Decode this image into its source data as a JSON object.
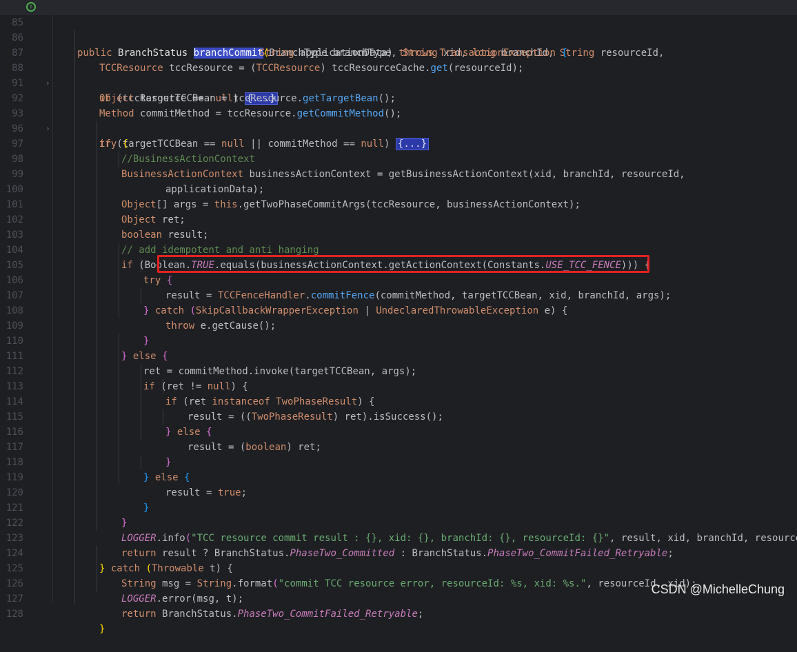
{
  "editor": {
    "watermark": "CSDN @MichelleChung",
    "gutter_icon": "implementation-marker-icon",
    "highlight_color": "#e32222",
    "lines": [
      {
        "n": "85"
      },
      {
        "n": "86"
      },
      {
        "n": "87"
      },
      {
        "n": "88"
      },
      {
        "n": "91"
      },
      {
        "n": "92"
      },
      {
        "n": "93"
      },
      {
        "n": "96"
      },
      {
        "n": "97"
      },
      {
        "n": "98"
      },
      {
        "n": "99"
      },
      {
        "n": "100"
      },
      {
        "n": "101"
      },
      {
        "n": "102"
      },
      {
        "n": "103"
      },
      {
        "n": "104"
      },
      {
        "n": "105"
      },
      {
        "n": "106"
      },
      {
        "n": "107"
      },
      {
        "n": "108"
      },
      {
        "n": "109"
      },
      {
        "n": "110"
      },
      {
        "n": "111"
      },
      {
        "n": "112"
      },
      {
        "n": "113"
      },
      {
        "n": "114"
      },
      {
        "n": "115"
      },
      {
        "n": "116"
      },
      {
        "n": "117"
      },
      {
        "n": "118"
      },
      {
        "n": "119"
      },
      {
        "n": "120"
      },
      {
        "n": "121"
      },
      {
        "n": "122"
      },
      {
        "n": "123"
      },
      {
        "n": "124"
      },
      {
        "n": "125"
      },
      {
        "n": "126"
      },
      {
        "n": "127"
      },
      {
        "n": "128"
      }
    ],
    "folded_block": "{...}",
    "text": {
      "l85a": "public ",
      "l85b": "BranchStatus ",
      "l85c": "branchCommit",
      "l85d": "(",
      "l85e": "BranchType branchType, ",
      "l85f": "String ",
      "l85g": "xid, ",
      "l85h": "long ",
      "l85i": "branchId, ",
      "l85j": "String ",
      "l85k": "resourceId,",
      "l86a": "String ",
      "l86b": "applicationData) ",
      "l86c": "throws ",
      "l86d": "TransactionException ",
      "l86e": "{",
      "l87a": "TCCResource ",
      "l87b": "tccResource = (",
      "l87c": "TCCResource",
      "l87d": ") tccResourceCache.",
      "l87e": "get",
      "l87f": "(resourceId);",
      "l88a": "if ",
      "l88b": "(tccResource == ",
      "l88c": "null",
      "l88d": ") ",
      "l91a": "Object ",
      "l91b": "targetTCCBean = tccResource.",
      "l91c": "getTargetBean",
      "l91d": "();",
      "l92a": "Method ",
      "l92b": "commitMethod = tccResource.",
      "l92c": "getCommitMethod",
      "l92d": "();",
      "l93a": "if ",
      "l93b": "(targetTCCBean == ",
      "l93c": "null",
      "l93d": " || commitMethod == ",
      "l93e": "null",
      "l93f": ") ",
      "l96a": "try ",
      "l96b": "{",
      "l97": "//BusinessActionContext",
      "l98a": "BusinessActionContext ",
      "l98b": "businessActionContext = ",
      "l98c": "getBusinessActionContext",
      "l98d": "(xid, branchId, resourceId,",
      "l99": "applicationData);",
      "l100a": "Object",
      "l100b": "[] args = ",
      "l100c": "this",
      "l100d": ".",
      "l100e": "getTwoPhaseCommitArgs",
      "l100f": "(tccResource, businessActionContext);",
      "l101a": "Object ",
      "l101b": "ret;",
      "l102a": "boolean ",
      "l102b": "result;",
      "l103": "// add idempotent and anti hanging",
      "l104a": "if ",
      "l104b": "(Boolean.",
      "l104c": "TRUE",
      "l104d": ".",
      "l104e": "equals",
      "l104f": "(businessActionContext.",
      "l104g": "getActionContext",
      "l104h": "(Constants.",
      "l104i": "USE_TCC_FENCE",
      "l104j": "))) {",
      "l105a": "try ",
      "l105b": "{",
      "l106a": "result = ",
      "l106b": "TCCFenceHandler",
      "l106c": ".",
      "l106d": "commitFence",
      "l106e": "(commitMethod, targetTCCBean, xid, branchId, args);",
      "l107a": "} ",
      "l107b": "catch ",
      "l107c": "(",
      "l107d": "SkipCallbackWrapperException",
      "l107e": " | ",
      "l107f": "UndeclaredThrowableException",
      "l107g": " e) {",
      "l108a": "throw ",
      "l108b": "e.",
      "l108c": "getCause",
      "l108d": "();",
      "l109": "}",
      "l110a": "} ",
      "l110b": "else ",
      "l110c": "{",
      "l111a": "ret = commitMethod.",
      "l111b": "invoke",
      "l111c": "(targetTCCBean, args);",
      "l112a": "if ",
      "l112b": "(ret != ",
      "l112c": "null",
      "l112d": ") {",
      "l113a": "if ",
      "l113b": "(ret ",
      "l113c": "instanceof ",
      "l113d": "TwoPhaseResult",
      "l113e": ") {",
      "l114a": "result = ((",
      "l114b": "TwoPhaseResult",
      "l114c": ") ret).",
      "l114d": "isSuccess",
      "l114e": "();",
      "l115a": "} ",
      "l115b": "else ",
      "l115c": "{",
      "l116a": "result = (",
      "l116b": "boolean",
      "l116c": ") ret;",
      "l117": "}",
      "l118a": "} ",
      "l118b": "else ",
      "l118c": "{",
      "l119a": "result = ",
      "l119b": "true",
      "l119c": ";",
      "l120": "}",
      "l121": "}",
      "l122a": "LOGGER",
      "l122b": ".",
      "l122c": "info",
      "l122d": "(",
      "l122e": "\"TCC resource commit result : {}, xid: {}, branchId: {}, resourceId: {}\"",
      "l122f": ", result, xid, branchId, resourceId);",
      "l123a": "return ",
      "l123b": "result ? BranchStatus.",
      "l123c": "PhaseTwo_Committed",
      "l123d": " : BranchStatus.",
      "l123e": "PhaseTwo_CommitFailed_Retryable",
      "l123f": ";",
      "l124a": "} ",
      "l124b": "catch ",
      "l124c": "(",
      "l124d": "Throwable ",
      "l124e": "t) {",
      "l125a": "String ",
      "l125b": "msg = ",
      "l125c": "String",
      "l125d": ".",
      "l125e": "format",
      "l125f": "(",
      "l125g": "\"commit TCC resource error, resourceId: %s, xid: %s.\"",
      "l125h": ", resourceId, xid);",
      "l126a": "LOGGER",
      "l126b": ".",
      "l126c": "error",
      "l126d": "(msg, t);",
      "l127a": "return ",
      "l127b": "BranchStatus.",
      "l127c": "PhaseTwo_CommitFailed_Retryable",
      "l127d": ";",
      "l128": "}"
    }
  }
}
